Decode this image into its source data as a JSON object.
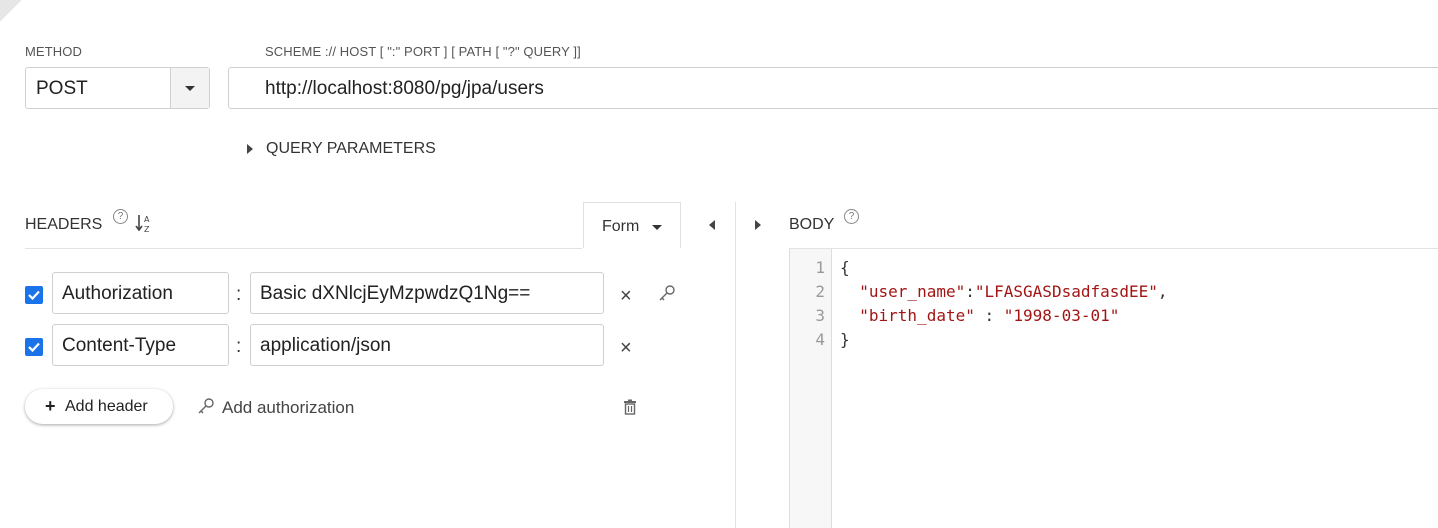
{
  "request": {
    "method_label": "METHOD",
    "method_value": "POST",
    "url_label": "SCHEME :// HOST [ \":\" PORT ] [ PATH [ \"?\" QUERY ]]",
    "url_value": "http://localhost:8080/pg/jpa/users",
    "query_params_label": "QUERY PARAMETERS"
  },
  "headers": {
    "title": "HEADERS",
    "help": "?",
    "form_label": "Form",
    "rows": [
      {
        "checked": true,
        "name": "Authorization",
        "value": "Basic dXNlcjEyMzpwdzQ1Ng=="
      },
      {
        "checked": true,
        "name": "Content-Type",
        "value": "application/json"
      }
    ],
    "add_header_label": "Add header",
    "add_authorization_label": "Add authorization"
  },
  "body": {
    "title": "BODY",
    "help": "?",
    "lines": [
      {
        "num": "1",
        "text": "{"
      },
      {
        "num": "2",
        "key": "\"user_name\"",
        "sep": ":",
        "value": "\"LFASGASDsadfasdEE\"",
        "tail": ","
      },
      {
        "num": "3",
        "key": "\"birth_date\"",
        "sep": " : ",
        "value": "\"1998-03-01\"",
        "tail": ""
      },
      {
        "num": "4",
        "text": "}"
      }
    ]
  }
}
